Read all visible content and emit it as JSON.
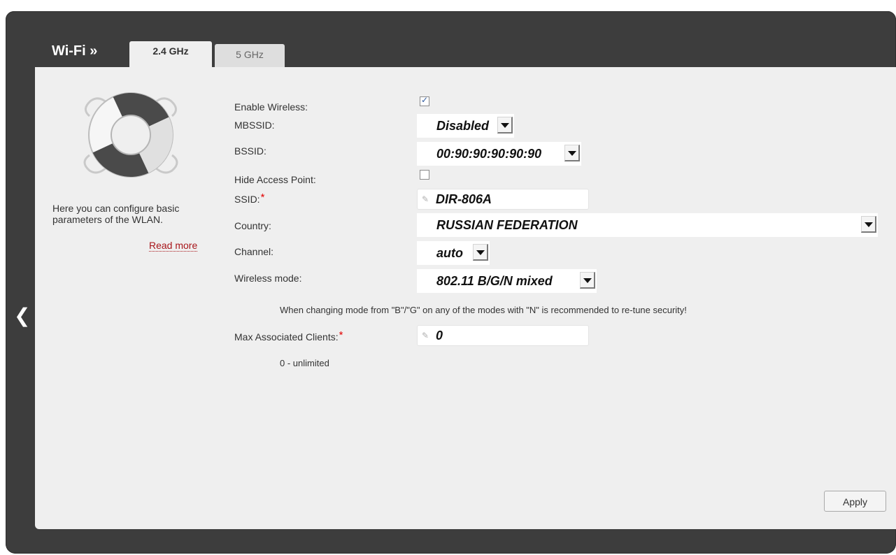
{
  "header": {
    "title": "Wi-Fi »",
    "tabs": [
      {
        "label": "2.4 GHz",
        "active": true
      },
      {
        "label": "5 GHz",
        "active": false
      }
    ]
  },
  "sidebar": {
    "icon": "lifebuoy-icon",
    "description": "Here you can configure basic parameters of the WLAN.",
    "read_more": "Read more"
  },
  "form": {
    "enable_wireless": {
      "label": "Enable Wireless:",
      "checked": true
    },
    "mbssid": {
      "label": "MBSSID:",
      "value": "Disabled"
    },
    "bssid": {
      "label": "BSSID:",
      "value": "00:90:90:90:90:90"
    },
    "hide_ap": {
      "label": "Hide Access Point:",
      "checked": false
    },
    "ssid": {
      "label": "SSID:",
      "required_mark": "*",
      "value": "DIR-806A"
    },
    "country": {
      "label": "Country:",
      "value": "RUSSIAN FEDERATION"
    },
    "channel": {
      "label": "Channel:",
      "value": "auto"
    },
    "wireless_mode": {
      "label": "Wireless mode:",
      "value": "802.11 B/G/N mixed"
    },
    "mode_note": "When changing mode from \"B\"/\"G\" on any of the modes with \"N\" is recommended to re-tune security!",
    "max_clients": {
      "label": "Max Associated Clients:",
      "required_mark": "*",
      "value": "0"
    },
    "max_clients_note": "0 - unlimited"
  },
  "actions": {
    "apply": "Apply"
  },
  "colors": {
    "frame": "#3d3d3d",
    "panel": "#efefef",
    "link": "#a8161b",
    "required": "#e20000"
  }
}
